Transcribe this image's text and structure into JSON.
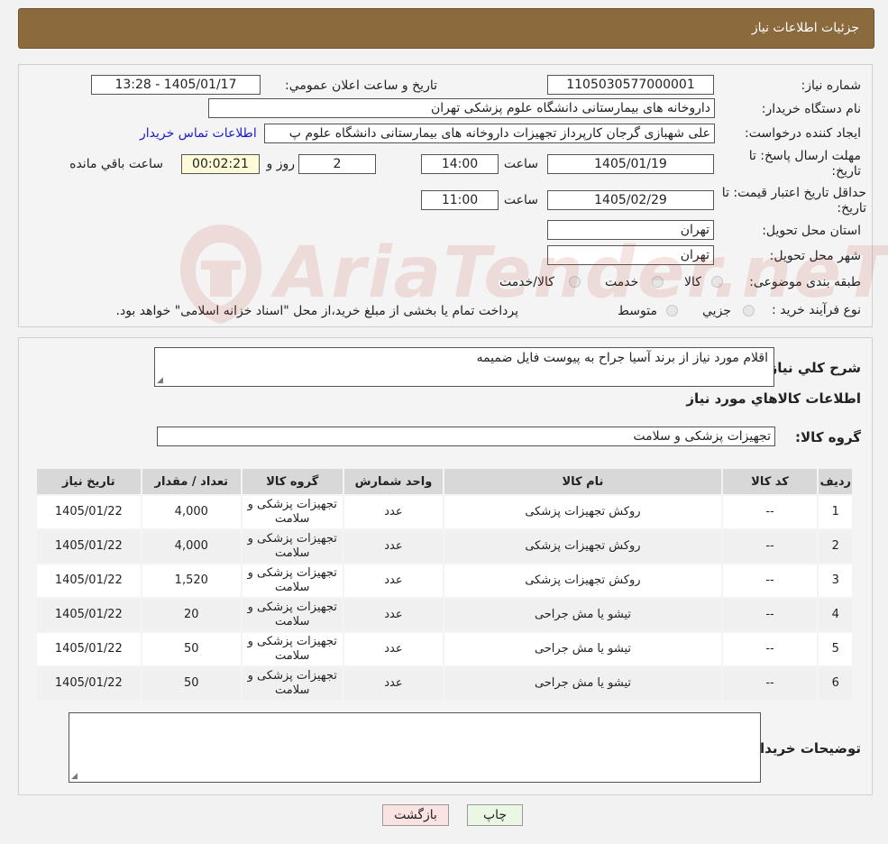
{
  "header": {
    "title": "جزئیات اطلاعات نیاز"
  },
  "form": {
    "need_number_label": "شماره نیاز:",
    "need_number": "1105030577000001",
    "announce_label": "تاریخ و ساعت اعلان عمومي:",
    "announce_value": "1405/01/17 - 13:28",
    "buyer_org_label": "نام دستگاه خریدار:",
    "buyer_org": "داروخانه های بیمارستانی دانشگاه علوم پزشکی تهران",
    "requester_label": "ایجاد کننده درخواست:",
    "requester": "علی شهبازی گرجان کارپرداز تجهیزات داروخانه های بیمارستانی دانشگاه علوم پ",
    "contact_link": "اطلاعات تماس خریدار",
    "deadline_label": "مهلت ارسال پاسخ: تا تاریخ:",
    "deadline_date": "1405/01/19",
    "time_label": "ساعت",
    "deadline_time": "14:00",
    "days_value": "2",
    "days_label": "روز و",
    "remaining_time": "00:02:21",
    "remaining_label": "ساعت باقي مانده",
    "validity_label": "حداقل تاریخ اعتبار قیمت: تا تاریخ:",
    "validity_date": "1405/02/29",
    "validity_time": "11:00",
    "province_label": "استان محل تحویل:",
    "province": "تهران",
    "city_label": "شهر محل تحویل:",
    "city": "تهران",
    "category_label": "طبقه بندی موضوعی:",
    "category_options": [
      "کالا",
      "خدمت",
      "کالا/خدمت"
    ],
    "process_label": "نوع فرآیند خرید :",
    "process_options": [
      "جزيي",
      "متوسط"
    ],
    "process_note": "پرداخت تمام یا بخشی از مبلغ خرید،از محل \"اسناد خزانه اسلامی\" خواهد بود."
  },
  "watermark": {
    "text": "AriaTender.neT"
  },
  "details": {
    "summary_label": "شرح کلي نیاز:",
    "summary": "اقلام مورد نیاز از برند آسیا جراح به پیوست فایل ضمیمه",
    "goods_info_title": "اطلاعات کالاهاي مورد نیاز",
    "goods_group_label": "گروه کالا:",
    "goods_group": "تجهیزات پزشکی و سلامت",
    "buyer_notes_label": "توضیحات خریدار:"
  },
  "table": {
    "headers": [
      "ردیف",
      "کد کالا",
      "نام کالا",
      "واحد شمارش",
      "گروه کالا",
      "تعداد / مقدار",
      "تاریخ نیاز"
    ],
    "rows": [
      [
        "1",
        "--",
        "روکش تجهیزات پزشکی",
        "عدد",
        "تجهیزات پزشکی و سلامت",
        "4,000",
        "1405/01/22"
      ],
      [
        "2",
        "--",
        "روکش تجهیزات پزشکی",
        "عدد",
        "تجهیزات پزشکی و سلامت",
        "4,000",
        "1405/01/22"
      ],
      [
        "3",
        "--",
        "روکش تجهیزات پزشکی",
        "عدد",
        "تجهیزات پزشکی و سلامت",
        "1,520",
        "1405/01/22"
      ],
      [
        "4",
        "--",
        "تیشو یا مش جراحی",
        "عدد",
        "تجهیزات پزشکی و سلامت",
        "20",
        "1405/01/22"
      ],
      [
        "5",
        "--",
        "تیشو یا مش جراحی",
        "عدد",
        "تجهیزات پزشکی و سلامت",
        "50",
        "1405/01/22"
      ],
      [
        "6",
        "--",
        "تیشو یا مش جراحی",
        "عدد",
        "تجهیزات پزشکی و سلامت",
        "50",
        "1405/01/22"
      ]
    ]
  },
  "buttons": {
    "print": "چاپ",
    "back": "بازگشت"
  }
}
